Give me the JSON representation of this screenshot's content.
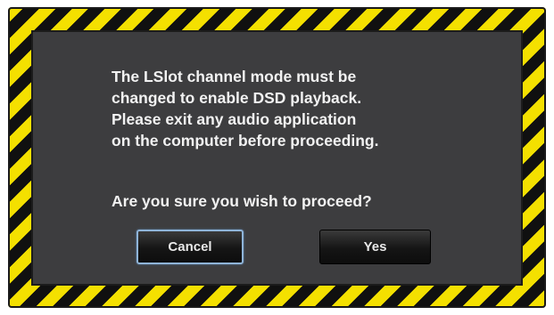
{
  "dialog": {
    "message_lines": [
      "The LSlot channel mode must be",
      "changed to enable DSD playback.",
      "Please exit any audio application",
      "on the computer before proceeding."
    ],
    "question": "Are you sure you wish to proceed?",
    "buttons": {
      "cancel_label": "Cancel",
      "yes_label": "Yes"
    }
  },
  "colors": {
    "stripe_yellow": "#f4e000",
    "stripe_black": "#101010",
    "panel_bg": "#3d3d3f",
    "text": "#f2f2f2",
    "focus_border": "#8fb4d8"
  }
}
